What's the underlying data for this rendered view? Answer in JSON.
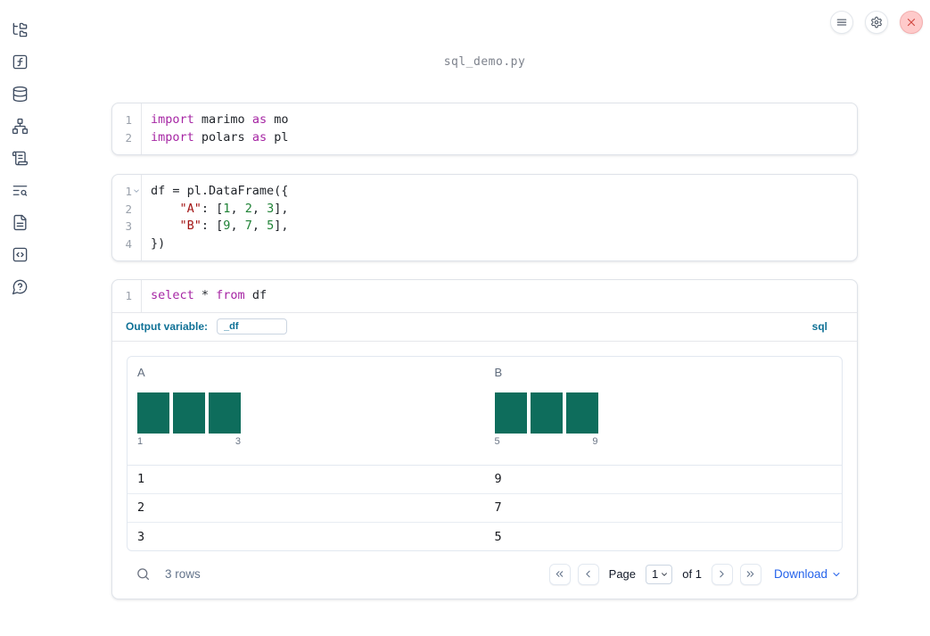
{
  "window": {
    "title": "sql_demo.py"
  },
  "topbar": {
    "buttons": [
      {
        "id": "notebook-menu",
        "icon": "hamburger-icon"
      },
      {
        "id": "settings",
        "icon": "gear-icon"
      },
      {
        "id": "shutdown",
        "icon": "close-x-icon"
      }
    ]
  },
  "sidebar": {
    "items": [
      {
        "id": "file-explorer",
        "icon": "file-tree-icon"
      },
      {
        "id": "variables",
        "icon": "function-square-icon"
      },
      {
        "id": "data-sources",
        "icon": "database-icon"
      },
      {
        "id": "dependencies",
        "icon": "network-graph-icon"
      },
      {
        "id": "outline",
        "icon": "scroll-icon"
      },
      {
        "id": "logs",
        "icon": "list-search-icon"
      },
      {
        "id": "documentation",
        "icon": "file-text-icon"
      },
      {
        "id": "snippets",
        "icon": "code-square-icon"
      },
      {
        "id": "help",
        "icon": "chat-question-icon"
      }
    ]
  },
  "cells": {
    "imports": {
      "lines": [
        {
          "n": "1",
          "segments": [
            [
              "kw",
              "import"
            ],
            [
              "pl",
              " marimo "
            ],
            [
              "kw",
              "as"
            ],
            [
              "pl",
              " mo"
            ]
          ]
        },
        {
          "n": "2",
          "segments": [
            [
              "kw",
              "import"
            ],
            [
              "pl",
              " polars "
            ],
            [
              "kw",
              "as"
            ],
            [
              "pl",
              " pl"
            ]
          ]
        }
      ]
    },
    "dataframe": {
      "lines": [
        {
          "n": "1",
          "fold": true,
          "segments": [
            [
              "pl",
              "df = pl.DataFrame({"
            ]
          ]
        },
        {
          "n": "2",
          "segments": [
            [
              "pl",
              "    "
            ],
            [
              "str",
              "\"A\""
            ],
            [
              "pl",
              ": ["
            ],
            [
              "num",
              "1"
            ],
            [
              "pl",
              ", "
            ],
            [
              "num",
              "2"
            ],
            [
              "pl",
              ", "
            ],
            [
              "num",
              "3"
            ],
            [
              "pl",
              "],"
            ]
          ]
        },
        {
          "n": "3",
          "segments": [
            [
              "pl",
              "    "
            ],
            [
              "str",
              "\"B\""
            ],
            [
              "pl",
              ": ["
            ],
            [
              "num",
              "9"
            ],
            [
              "pl",
              ", "
            ],
            [
              "num",
              "7"
            ],
            [
              "pl",
              ", "
            ],
            [
              "num",
              "5"
            ],
            [
              "pl",
              "],"
            ]
          ]
        },
        {
          "n": "4",
          "segments": [
            [
              "pl",
              "})"
            ]
          ]
        }
      ]
    },
    "sql": {
      "lines": [
        {
          "n": "1",
          "segments": [
            [
              "kw",
              "select"
            ],
            [
              "pl",
              " * "
            ],
            [
              "kw",
              "from"
            ],
            [
              "pl",
              " df"
            ]
          ]
        }
      ],
      "output_variable_label": "Output variable:",
      "output_variable_value": "_df",
      "language_badge": "sql"
    }
  },
  "table": {
    "columns": [
      {
        "label": "A",
        "hist": {
          "type": "bar",
          "values": [
            1,
            1,
            1
          ],
          "min_label": "1",
          "max_label": "3"
        }
      },
      {
        "label": "B",
        "hist": {
          "type": "bar",
          "values": [
            1,
            1,
            1
          ],
          "min_label": "5",
          "max_label": "9"
        }
      }
    ],
    "rows": [
      [
        "1",
        "9"
      ],
      [
        "2",
        "7"
      ],
      [
        "3",
        "5"
      ]
    ],
    "row_count": "3 rows",
    "pagination": {
      "page_label": "Page",
      "page_value": "1",
      "of_label": "of 1"
    },
    "download_label": "Download"
  },
  "colors": {
    "accent_teal_blue": "#0f7196",
    "link_blue": "#2563eb",
    "histogram_bar": "#0e6d5c",
    "keyword": "#a626a4",
    "string": "#a31515",
    "number": "#1f8236",
    "danger": "#d24a43"
  }
}
